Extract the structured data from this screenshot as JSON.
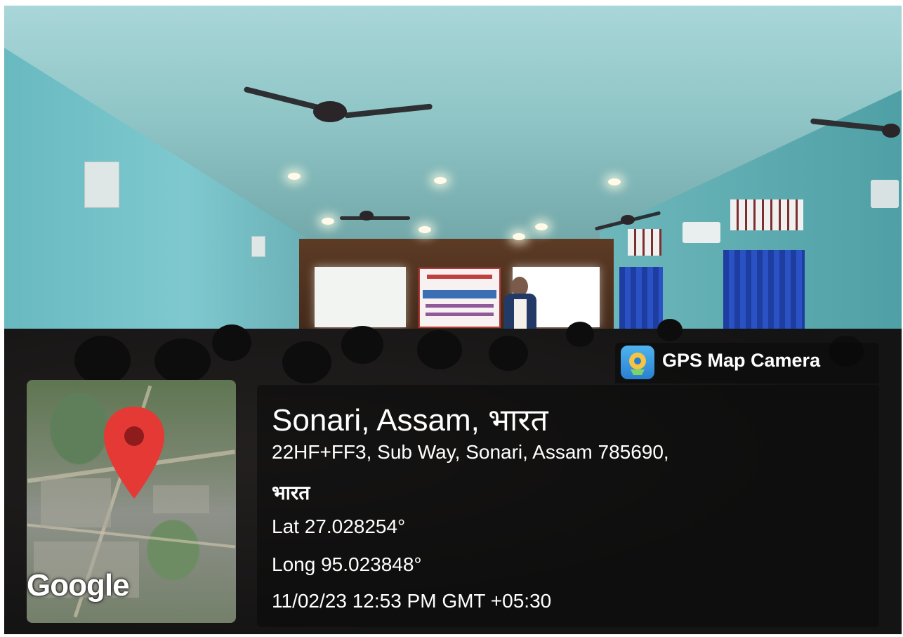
{
  "watermark": {
    "app_name": "GPS Map Camera",
    "app_icon": "map-pin-camera-icon"
  },
  "location": {
    "title": "Sonari, Assam, भारत",
    "address_line1": "22HF+FF3, Sub Way, Sonari, Assam 785690,",
    "address_line2": "भारत",
    "latitude": "Lat 27.028254°",
    "longitude": "Long 95.023848°",
    "datetime": "11/02/23 12:53 PM GMT +05:30"
  },
  "map": {
    "provider_logo": "Google",
    "pin_icon": "location-pin-icon",
    "pin_color": "#e53935"
  },
  "photo": {
    "banner_lines": [
      "AWARENESS PROGRAMME",
      "ON",
      "SONARI COLLEGE"
    ]
  },
  "colors": {
    "wall": "#7ec9cf",
    "curtain": "#2a52c4",
    "overlay": "rgba(10,10,10,0.55)",
    "text": "#ffffff"
  }
}
